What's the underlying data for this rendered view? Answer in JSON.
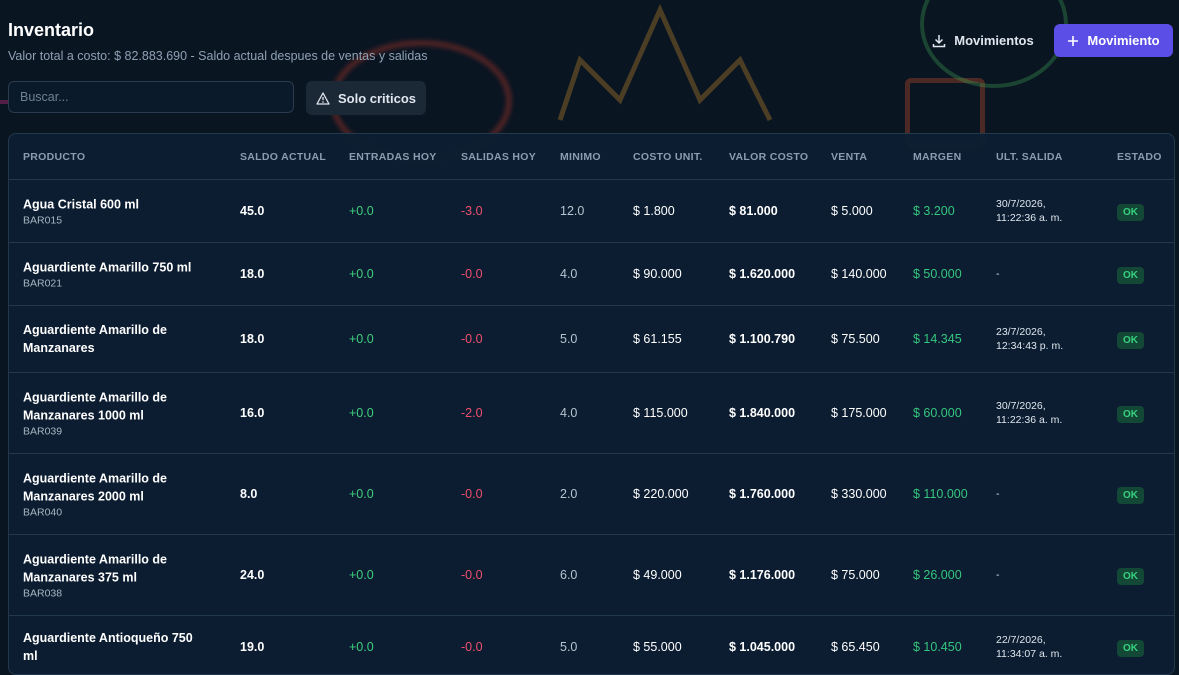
{
  "header": {
    "title": "Inventario",
    "subtitle": "Valor total a costo: $ 82.883.690 - Saldo actual despues de ventas y salidas"
  },
  "actions": {
    "movimientos_label": "Movimientos",
    "nuevo_label": "Movimiento",
    "accent_color": "#5b4ee6"
  },
  "filters": {
    "search_placeholder": "Buscar...",
    "critical_label": "Solo criticos"
  },
  "table": {
    "columns": [
      "PRODUCTO",
      "SALDO ACTUAL",
      "ENTRADAS HOY",
      "SALIDAS HOY",
      "MINIMO",
      "COSTO UNIT.",
      "VALOR COSTO",
      "VENTA",
      "MARGEN",
      "ULT. SALIDA",
      "ESTADO"
    ],
    "rows": [
      {
        "name": "Agua Cristal 600 ml",
        "code": "BAR015",
        "saldo": "45.0",
        "entradas": "+0.0",
        "salidas": "-3.0",
        "minimo": "12.0",
        "costo": "$ 1.800",
        "valor": "$ 81.000",
        "venta": "$ 5.000",
        "margen": "$ 3.200",
        "ult_salida": "30/7/2026,\n11:22:36 a. m.",
        "estado": "OK"
      },
      {
        "name": "Aguardiente Amarillo 750 ml",
        "code": "BAR021",
        "saldo": "18.0",
        "entradas": "+0.0",
        "salidas": "-0.0",
        "minimo": "4.0",
        "costo": "$ 90.000",
        "valor": "$ 1.620.000",
        "venta": "$ 140.000",
        "margen": "$ 50.000",
        "ult_salida": "-",
        "estado": "OK"
      },
      {
        "name": "Aguardiente Amarillo de Manzanares",
        "code": "",
        "saldo": "18.0",
        "entradas": "+0.0",
        "salidas": "-0.0",
        "minimo": "5.0",
        "costo": "$ 61.155",
        "valor": "$ 1.100.790",
        "venta": "$ 75.500",
        "margen": "$ 14.345",
        "ult_salida": "23/7/2026,\n12:34:43 p. m.",
        "estado": "OK"
      },
      {
        "name": "Aguardiente Amarillo de Manzanares 1000 ml",
        "code": "BAR039",
        "saldo": "16.0",
        "entradas": "+0.0",
        "salidas": "-2.0",
        "minimo": "4.0",
        "costo": "$ 115.000",
        "valor": "$ 1.840.000",
        "venta": "$ 175.000",
        "margen": "$ 60.000",
        "ult_salida": "30/7/2026,\n11:22:36 a. m.",
        "estado": "OK"
      },
      {
        "name": "Aguardiente Amarillo de Manzanares 2000 ml",
        "code": "BAR040",
        "saldo": "8.0",
        "entradas": "+0.0",
        "salidas": "-0.0",
        "minimo": "2.0",
        "costo": "$ 220.000",
        "valor": "$ 1.760.000",
        "venta": "$ 330.000",
        "margen": "$ 110.000",
        "ult_salida": "-",
        "estado": "OK"
      },
      {
        "name": "Aguardiente Amarillo de Manzanares 375 ml",
        "code": "BAR038",
        "saldo": "24.0",
        "entradas": "+0.0",
        "salidas": "-0.0",
        "minimo": "6.0",
        "costo": "$ 49.000",
        "valor": "$ 1.176.000",
        "venta": "$ 75.000",
        "margen": "$ 26.000",
        "ult_salida": "-",
        "estado": "OK"
      },
      {
        "name": "Aguardiente Antioqueño 750 ml",
        "code": "",
        "saldo": "19.0",
        "entradas": "+0.0",
        "salidas": "-0.0",
        "minimo": "5.0",
        "costo": "$ 55.000",
        "valor": "$ 1.045.000",
        "venta": "$ 65.450",
        "margen": "$ 10.450",
        "ult_salida": "22/7/2026,\n11:34:07 a. m.",
        "estado": "OK"
      }
    ]
  }
}
